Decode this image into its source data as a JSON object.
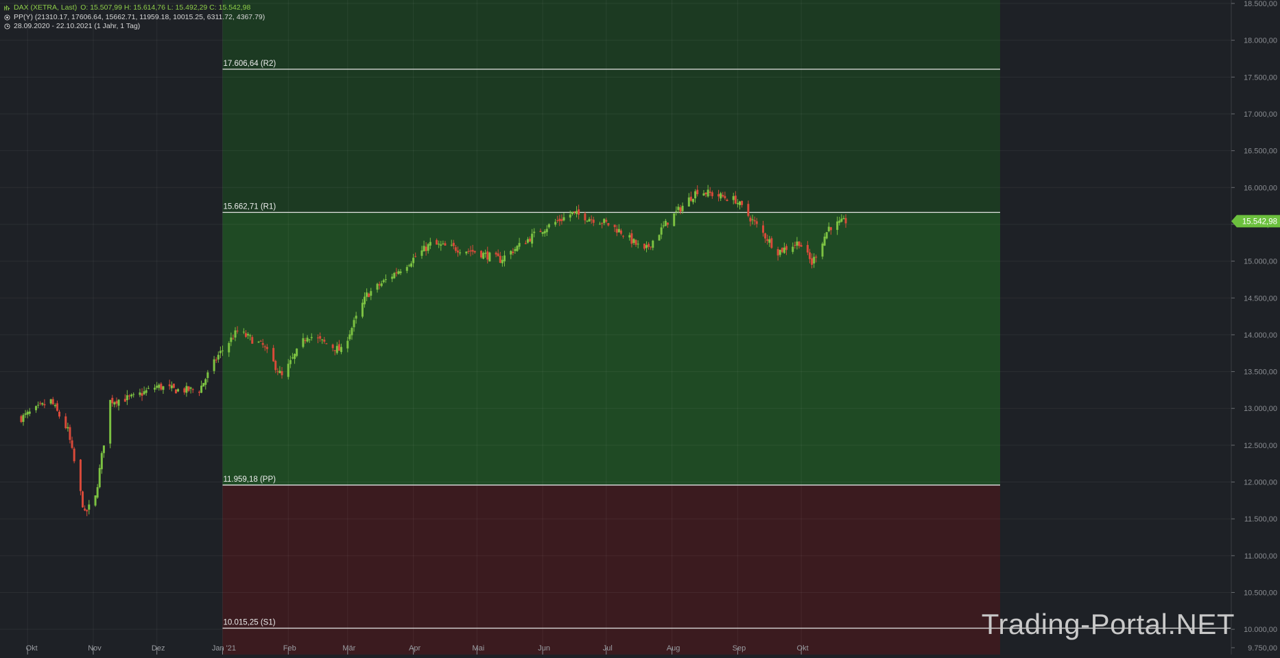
{
  "header": {
    "instrument": "DAX (XETRA, Last)",
    "ohlc": "O: 15.507,99  H: 15.614,76  L: 15.492,29  C: 15.542,98",
    "indicator": "PP(Y)  (21310.17, 17606.64, 15662.71, 11959.18, 10015.25, 6311.72, 4367.79)",
    "range": "28.09.2020 - 22.10.2021   (1 Jahr, 1 Tag)"
  },
  "watermark": "Trading-Portal.NET",
  "colors": {
    "background": "#1e2126",
    "up": "#7cc242",
    "down": "#d94a3a",
    "green_zone": "#1c3a22",
    "green_zone_strong": "#1f4a24",
    "red_zone": "#3b1b1f",
    "price_badge": "#6cc03e"
  },
  "chart_data": {
    "type": "candlestick",
    "title": "DAX (XETRA, Last)",
    "ylim": [
      9750,
      18500
    ],
    "y_ticks": [
      "18.500,00",
      "18.000,00",
      "17.500,00",
      "17.000,00",
      "16.500,00",
      "16.000,00",
      "15.500,00",
      "15.000,00",
      "14.500,00",
      "14.000,00",
      "13.500,00",
      "13.000,00",
      "12.500,00",
      "12.000,00",
      "11.500,00",
      "11.000,00",
      "10.500,00",
      "10.000,00",
      "9.750,00"
    ],
    "y_tick_values": [
      18500,
      18000,
      17500,
      17000,
      16500,
      16000,
      15500,
      15000,
      14500,
      14000,
      13500,
      13000,
      12500,
      12000,
      11500,
      11000,
      10500,
      10000,
      9750
    ],
    "x_ticks": [
      "Okt",
      "Nov",
      "Dez",
      "Jan '21",
      "Feb",
      "Mär",
      "Apr",
      "Mai",
      "Jun",
      "Jul",
      "Aug",
      "Sep",
      "Okt"
    ],
    "x_tick_dates": [
      "2020-10-01",
      "2020-11-01",
      "2020-12-01",
      "2021-01-01",
      "2021-02-01",
      "2021-03-01",
      "2021-04-01",
      "2021-05-01",
      "2021-06-01",
      "2021-07-01",
      "2021-08-01",
      "2021-09-01",
      "2021-10-01"
    ],
    "last_price": 15542.98,
    "last_price_label": "15.542,98",
    "pivot_levels": [
      {
        "label": "17.606,64 (R2)",
        "value": 17606.64
      },
      {
        "label": "15.662,71 (R1)",
        "value": 15662.71
      },
      {
        "label": "11.959,18 (PP)",
        "value": 11959.18
      },
      {
        "label": "10.015,25 (S1)",
        "value": 10015.25
      }
    ],
    "pivot_period": [
      "2021-01-01",
      "2021-12-31"
    ],
    "monthly_path": [
      {
        "date": "2020-09-28",
        "close": 12870
      },
      {
        "date": "2020-10-12",
        "close": 13100
      },
      {
        "date": "2020-10-20",
        "close": 12700
      },
      {
        "date": "2020-10-28",
        "close": 11560
      },
      {
        "date": "2020-11-02",
        "close": 11790
      },
      {
        "date": "2020-11-09",
        "close": 13100
      },
      {
        "date": "2020-11-20",
        "close": 13150
      },
      {
        "date": "2020-12-01",
        "close": 13300
      },
      {
        "date": "2020-12-10",
        "close": 13250
      },
      {
        "date": "2020-12-21",
        "close": 13250
      },
      {
        "date": "2020-12-30",
        "close": 13720
      },
      {
        "date": "2021-01-08",
        "close": 14050
      },
      {
        "date": "2021-01-20",
        "close": 13850
      },
      {
        "date": "2021-01-29",
        "close": 13430
      },
      {
        "date": "2021-02-10",
        "close": 14000
      },
      {
        "date": "2021-02-26",
        "close": 13780
      },
      {
        "date": "2021-03-10",
        "close": 14540
      },
      {
        "date": "2021-03-31",
        "close": 15010
      },
      {
        "date": "2021-04-09",
        "close": 15230
      },
      {
        "date": "2021-04-30",
        "close": 15130
      },
      {
        "date": "2021-05-12",
        "close": 15020
      },
      {
        "date": "2021-05-31",
        "close": 15420
      },
      {
        "date": "2021-06-15",
        "close": 15650
      },
      {
        "date": "2021-06-30",
        "close": 15530
      },
      {
        "date": "2021-07-08",
        "close": 15400
      },
      {
        "date": "2021-07-19",
        "close": 15130
      },
      {
        "date": "2021-07-30",
        "close": 15540
      },
      {
        "date": "2021-08-13",
        "close": 15960
      },
      {
        "date": "2021-08-31",
        "close": 15830
      },
      {
        "date": "2021-09-20",
        "close": 15130
      },
      {
        "date": "2021-09-30",
        "close": 15260
      },
      {
        "date": "2021-10-06",
        "close": 14970
      },
      {
        "date": "2021-10-14",
        "close": 15460
      },
      {
        "date": "2021-10-22",
        "close": 15543
      }
    ]
  }
}
